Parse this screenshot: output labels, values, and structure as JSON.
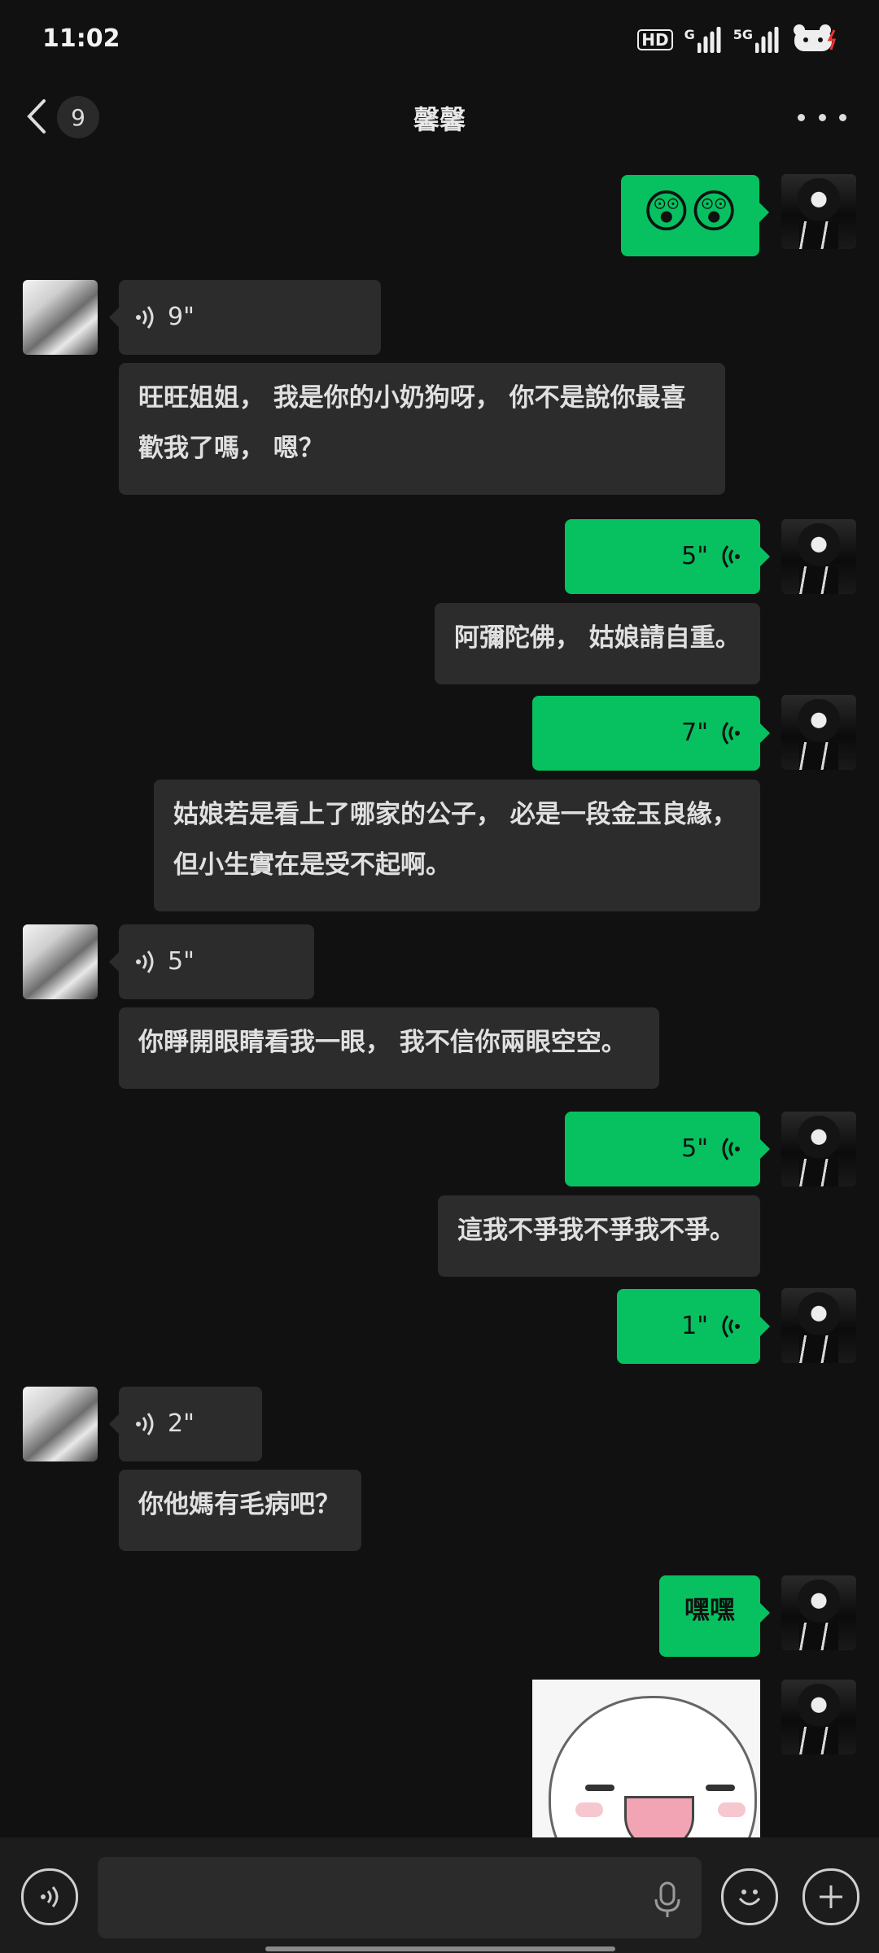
{
  "status": {
    "time": "11:02",
    "hd": "HD",
    "net1": "G",
    "net2": "5G"
  },
  "header": {
    "unread": "9",
    "title": "馨馨"
  },
  "messages": {
    "m1": "😲😲",
    "m2": "9\"",
    "m3": "旺旺姐姐， 我是你的小奶狗呀， 你不是說你最喜歡我了嗎， 嗯？",
    "m4": "5\"",
    "m5": "阿彌陀佛， 姑娘請自重。",
    "m6": "7\"",
    "m7": "姑娘若是看上了哪家的公子， 必是一段金玉良緣， 但小生實在是受不起啊。",
    "m8": "5\"",
    "m9": "你睜開眼睛看我一眼， 我不信你兩眼空空。",
    "m10": "5\"",
    "m11": "這我不爭我不爭我不爭。",
    "m12": "1\"",
    "m13": "2\"",
    "m14": "你他媽有毛病吧？",
    "m15": "嘿嘿"
  },
  "icons": {
    "back": "chevron-left-icon",
    "more": "more-icon",
    "voice_toggle": "voice-icon",
    "mic": "mic-icon",
    "emoji": "emoji-icon",
    "plus": "plus-icon"
  },
  "colors": {
    "background": "#111111",
    "outgoing_bubble": "#07c160",
    "incoming_bubble": "#2c2c2c"
  }
}
